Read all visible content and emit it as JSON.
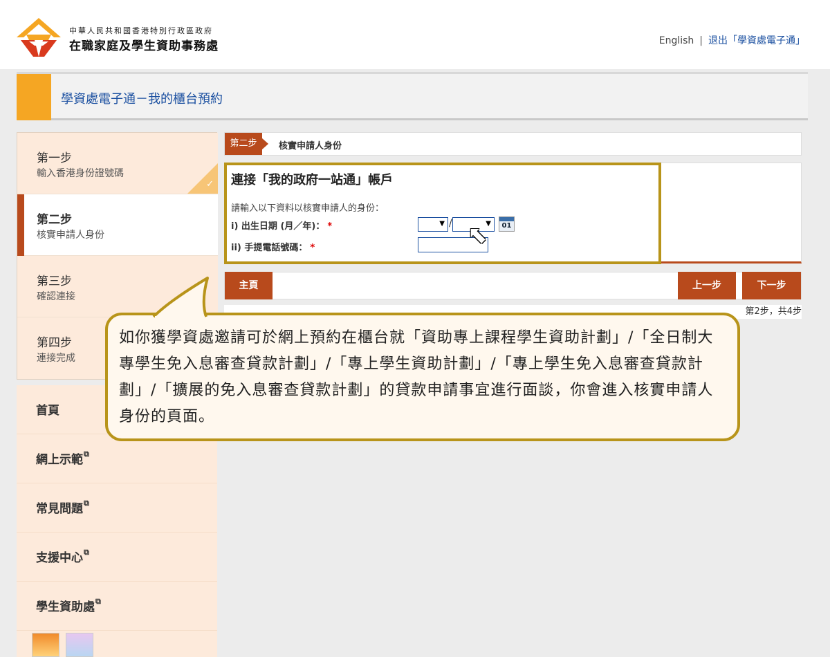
{
  "header": {
    "org_line1": "中華人民共和國香港特別行政區政府",
    "org_line2": "在職家庭及學生資助事務處",
    "lang_link": "English",
    "separator": "|",
    "logout_link": "退出「學資處電子通」"
  },
  "page_title": "學資處電子通－我的櫃台預約",
  "steps": [
    {
      "title": "第一步",
      "subtitle": "輸入香港身份證號碼",
      "state": "completed"
    },
    {
      "title": "第二步",
      "subtitle": "核實申請人身份",
      "state": "active"
    },
    {
      "title": "第三步",
      "subtitle": "確認連接",
      "state": "pending"
    },
    {
      "title": "第四步",
      "subtitle": "連接完成",
      "state": "pending"
    }
  ],
  "menu": {
    "items": [
      {
        "label": "首頁",
        "external": false
      },
      {
        "label": "網上示範",
        "external": true
      },
      {
        "label": "常見問題",
        "external": true
      },
      {
        "label": "支援中心",
        "external": true
      },
      {
        "label": "學生資助處",
        "external": true
      }
    ],
    "external_icon": "external-link-icon"
  },
  "stepbar": {
    "badge": "第二步",
    "name": "核實申請人身份"
  },
  "form": {
    "title": "連接「我的政府一站通」帳戶",
    "description": "請輸入以下資料以核實申請人的身份：",
    "dob_label": "i) 出生日期 (月／年)：",
    "phone_label": "ii) 手提電話號碼：",
    "required_mark": "*",
    "slash": "/",
    "calendar_text": "01",
    "month_value": "",
    "year_value": "",
    "phone_value": ""
  },
  "nav": {
    "home": "主頁",
    "prev": "上一步",
    "next": "下一步"
  },
  "page_info": "第2步，共4步",
  "callout_text": "如你獲學資處邀請可於網上預約在櫃台就「資助專上課程學生資助計劃」/「全日制大專學生免入息審查貸款計劃」/「專上學生資助計劃」/「專上學生免入息審查貸款計劃」/「擴展的免入息審查貸款計劃」的貸款申請事宜進行面談，你會進入核實申請人身份的頁面。",
  "colors": {
    "brand_red": "#b84a1c",
    "accent_orange": "#f5a623",
    "highlight_gold": "#b8941a",
    "link_blue": "#1a4fa0"
  }
}
